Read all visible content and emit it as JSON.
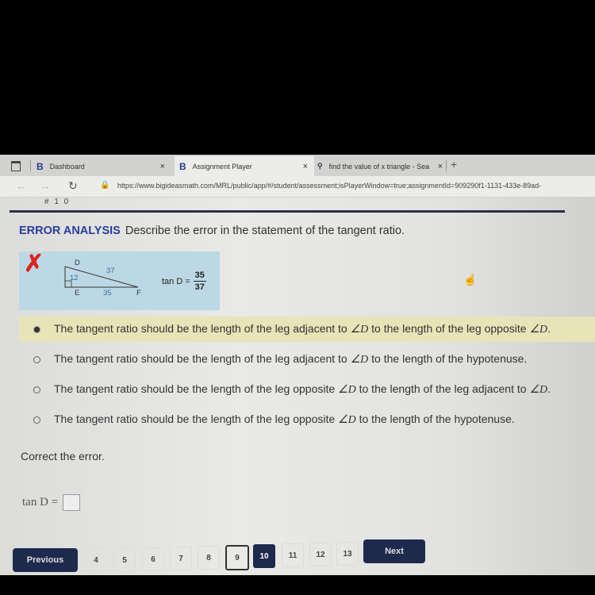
{
  "browser": {
    "tabs": [
      {
        "label": "Dashboard",
        "icon": "bigideas-logo",
        "logo_glyph": "B",
        "close": "×"
      },
      {
        "label": "Assignment Player",
        "icon": "bigideas-logo",
        "logo_glyph": "B",
        "close": "×",
        "active": true
      },
      {
        "label": "find the value of x triangle - Sea",
        "icon": "search-icon",
        "logo_glyph": "⚲",
        "close": "×"
      }
    ],
    "new_tab": "+",
    "back": "←",
    "forward": "→",
    "reload": "↻",
    "lock": "🔒",
    "url": "https://www.bigideasmath.com/MRL/public/app/#/student/assessment;isPlayerWindow=true;assignmentId=909290f1-1131-433e-89ad-"
  },
  "question": {
    "number_partial": "# 1 0",
    "heading": "ERROR ANALYSIS",
    "prompt": "Describe the error in the statement of the tangent ratio.",
    "accent_color": "#2a3d9c",
    "figure": {
      "error_mark": "✗",
      "vertices": {
        "D": "D",
        "E": "E",
        "F": "F"
      },
      "sides": {
        "DE": "12",
        "DF": "37",
        "EF": "35"
      },
      "statement_lhs": "tan D =",
      "numerator": "35",
      "denominator": "37"
    },
    "options": [
      {
        "pre": "The tangent ratio should be the length of the leg adjacent to ",
        "ang1": "∠D",
        "mid": " to the length of the leg opposite ",
        "ang2": "∠D",
        "post": ".",
        "selected": true
      },
      {
        "pre": "The tangent ratio should be the length of the leg adjacent to ",
        "ang1": "∠D",
        "mid": " to the length of the hypotenuse.",
        "ang2": "",
        "post": "",
        "selected": false
      },
      {
        "pre": "The tangent ratio should be the length of the leg opposite ",
        "ang1": "∠D",
        "mid": " to the length of the leg adjacent to ",
        "ang2": "∠D",
        "post": ".",
        "selected": false
      },
      {
        "pre": "The tangent ratio should be the length of the leg opposite ",
        "ang1": "∠D",
        "mid": " to the length of the hypotenuse.",
        "ang2": "",
        "post": "",
        "selected": false
      }
    ],
    "correct_prompt": "Correct the error.",
    "answer_label": "tan D =",
    "answer_value": ""
  },
  "pagination": {
    "previous": "Previous",
    "next": "Next",
    "pages": [
      "4",
      "5",
      "6",
      "7",
      "8",
      "9",
      "10",
      "11",
      "12",
      "13"
    ],
    "current": "10",
    "outlined": "9"
  }
}
